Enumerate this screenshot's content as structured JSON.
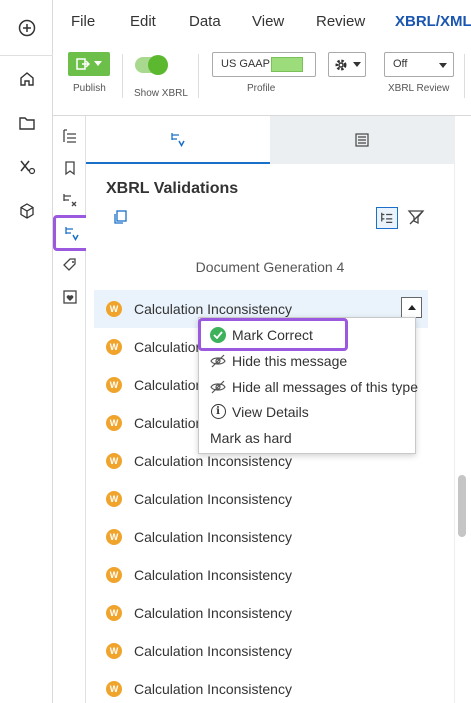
{
  "menu": {
    "items": [
      "File",
      "Edit",
      "Data",
      "View",
      "Review"
    ],
    "active": "XBRL/XML"
  },
  "toolbar": {
    "publish_label": "Publish",
    "show_xbrl_label": "Show XBRL",
    "profile_value": "US GAAP",
    "profile_label": "Profile",
    "xbrl_review_value": "Off",
    "xbrl_review_label": "XBRL Review",
    "show_xbrl_on": true
  },
  "panel": {
    "title": "XBRL Validations",
    "group_title": "Document Generation 4",
    "tabs": [
      "validations-tab",
      "details-tab"
    ]
  },
  "validations": {
    "badge": "W",
    "items": [
      "Calculation Inconsistency",
      "Calculation",
      "Calculation",
      "Calculation",
      "Calculation Inconsistency",
      "Calculation Inconsistency",
      "Calculation Inconsistency",
      "Calculation Inconsistency",
      "Calculation Inconsistency",
      "Calculation Inconsistency",
      "Calculation Inconsistency"
    ]
  },
  "context_menu": {
    "mark_correct": "Mark Correct",
    "hide_message": "Hide this message",
    "hide_all": "Hide all messages of this type",
    "view_details": "View Details",
    "mark_hard": "Mark as hard"
  },
  "colors": {
    "accent": "#1a56b0",
    "highlight_outline": "#9b59e0",
    "warning_badge": "#f0a42c",
    "publish_green": "#6cc04a",
    "check_green": "#3eb15b"
  }
}
